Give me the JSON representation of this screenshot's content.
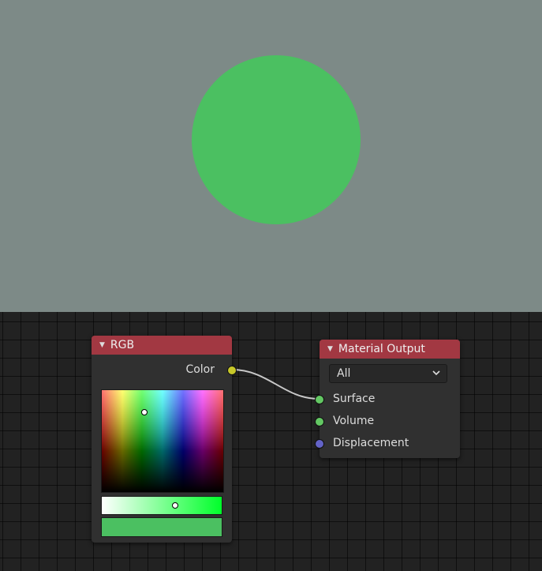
{
  "viewport": {
    "preview_color": "#4bc061",
    "background_color": "#7d8a87"
  },
  "rgb_node": {
    "title": "RGB",
    "header_color": "#a23842",
    "output_label": "Color",
    "output_socket_color": "#c7c729",
    "swatch_color": "#4bc061"
  },
  "output_node": {
    "title": "Material Output",
    "header_color": "#a23842",
    "target": "All",
    "inputs": [
      {
        "label": "Surface",
        "socket_color": "#63c763"
      },
      {
        "label": "Volume",
        "socket_color": "#63c763"
      },
      {
        "label": "Displacement",
        "socket_color": "#6363c7"
      }
    ]
  }
}
